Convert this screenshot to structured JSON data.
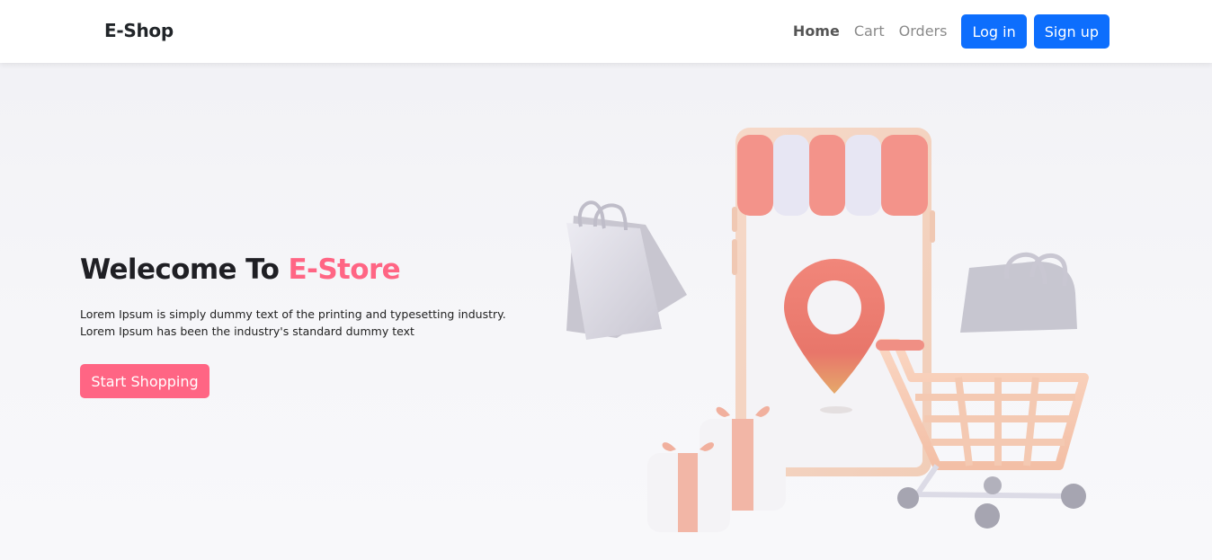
{
  "navbar": {
    "brand": "E-Shop",
    "links": [
      {
        "label": "Home",
        "active": true
      },
      {
        "label": "Cart",
        "active": false
      },
      {
        "label": "Orders",
        "active": false
      }
    ],
    "login_label": "Log in",
    "signup_label": "Sign up"
  },
  "hero": {
    "title_prefix": "Welecome To ",
    "title_accent": "E-Store",
    "text_line1": "Lorem Ipsum is simply dummy text of the printing and typesetting industry.",
    "text_line2": "Lorem Ipsum has been the industry's standard dummy text",
    "cta_label": "Start Shopping"
  },
  "colors": {
    "primary": "#0d6efd",
    "accent": "#ff6584",
    "text_dark": "#212529"
  },
  "illustration": {
    "icon": "online-store-illustration"
  }
}
